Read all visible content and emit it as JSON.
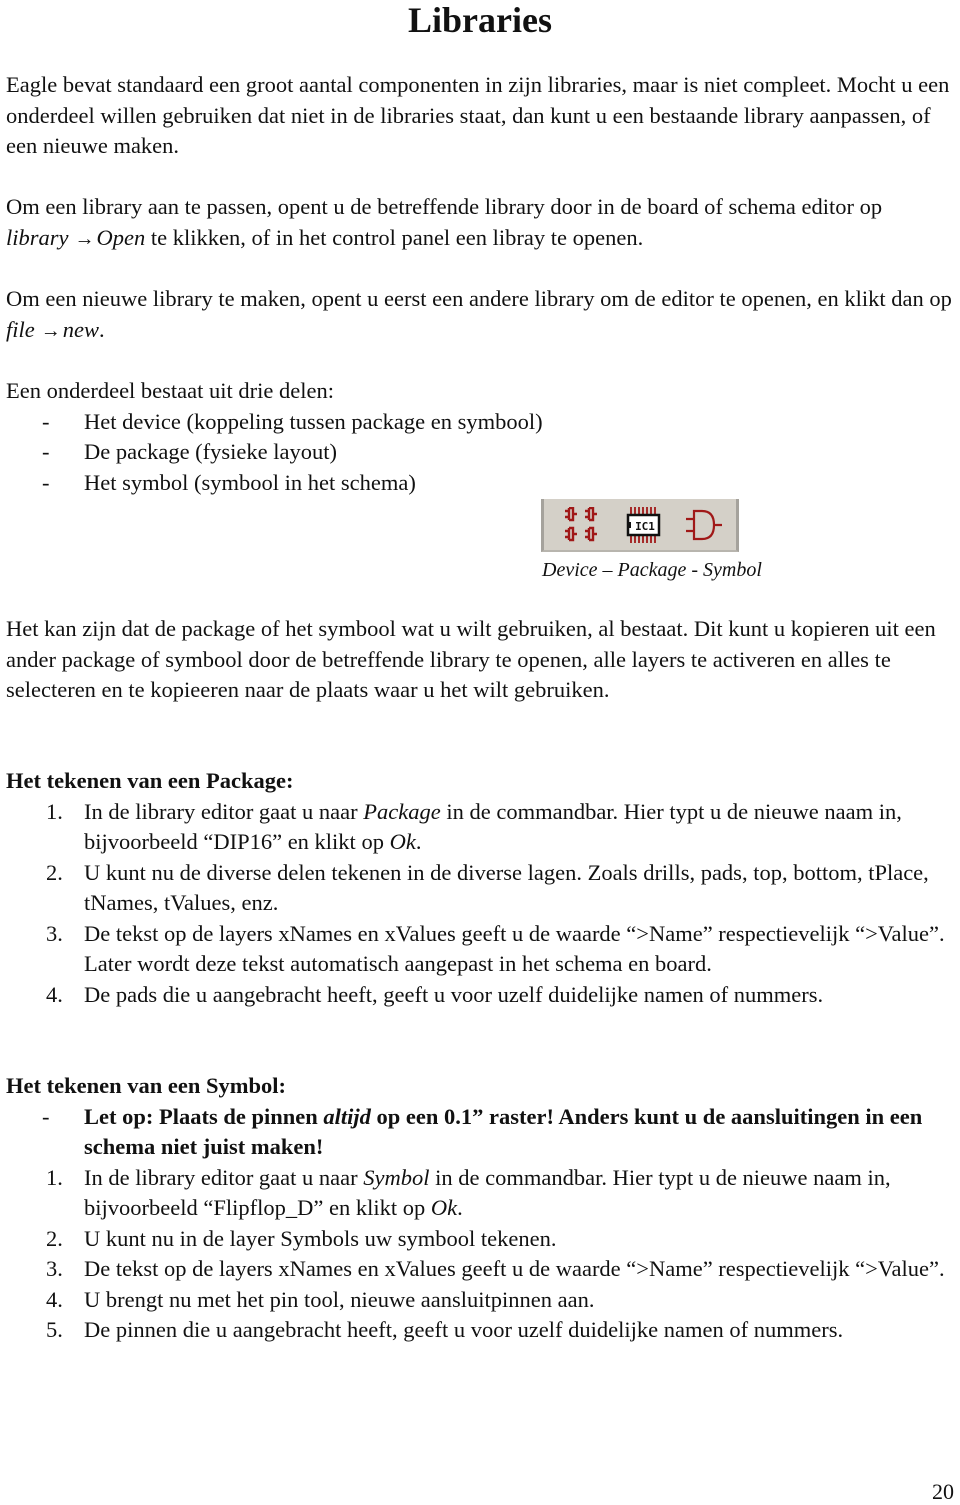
{
  "title": "Libraries",
  "intro": "Eagle bevat standaard een groot aantal componenten in zijn libraries, maar is niet compleet. Mocht u een onderdeel willen gebruiken dat niet in de libraries staat, dan kunt u een bestaande library aanpassen, of een nieuwe maken.",
  "open_library": {
    "before": "Om een library aan te passen, opent u de betreffende library door in de board of schema editor op ",
    "menu1": "library",
    "arrow": "→",
    "menu2": "Open",
    "after": " te klikken, of in het control panel een libray te openen."
  },
  "new_library": {
    "before": "Om een nieuwe library te maken, opent u eerst een andere library om de editor te openen, en klikt dan op ",
    "menu1": "file",
    "arrow": "→",
    "menu2": "new",
    "after": "."
  },
  "parts": {
    "intro": "Een onderdeel bestaat uit drie delen:",
    "marker": "-",
    "items": [
      "Het device (koppeling tussen package en symbool)",
      "De package (fysieke layout)",
      "Het symbol (symbool in het schema)"
    ]
  },
  "toolbar": {
    "icons": [
      "device-icon",
      "package-icon",
      "symbol-icon"
    ],
    "chip_label": "IC1",
    "icon_color": "#a01818",
    "background": "#d4d0c8",
    "caption": "Device – Package - Symbol"
  },
  "copy_paragraph": "Het kan zijn dat de package of het symbool wat u wilt gebruiken, al bestaat. Dit kunt u kopieren uit een ander package of symbool door de betreffende library te openen, alle layers te activeren en alles te selecteren en te kopieeren naar de plaats waar u het wilt gebruiken.",
  "package_section": {
    "heading": "Het tekenen van een Package:",
    "steps": [
      {
        "num": "1.",
        "a": "In de library editor gaat u naar ",
        "em": "Package",
        "b": " in de commandbar. Hier typt u de nieuwe naam in, bijvoorbeeld “DIP16” en klikt op ",
        "em2": "Ok",
        "c": "."
      },
      {
        "num": "2.",
        "text": "U kunt nu de diverse delen tekenen in de diverse lagen. Zoals drills, pads, top, bottom, tPlace, tNames, tValues, enz."
      },
      {
        "num": "3.",
        "text": "De tekst op de layers xNames en xValues geeft u de waarde “>Name” respectievelijk “>Value”. Later wordt deze tekst automatisch aangepast in het schema en board."
      },
      {
        "num": "4.",
        "text": "De pads die u aangebracht heeft, geeft u voor uzelf duidelijke namen of nummers."
      }
    ]
  },
  "symbol_section": {
    "heading": "Het tekenen van een Symbol:",
    "warning": {
      "marker": "-",
      "a": "Let op: Plaats de pinnen ",
      "em": "altijd",
      "b": " op een 0.1” raster! Anders kunt u de aansluitingen in een schema niet juist maken!"
    },
    "steps": [
      {
        "num": "1.",
        "a": "In de library editor gaat u naar ",
        "em": "Symbol",
        "b": " in de commandbar. Hier typt u de nieuwe naam in, bijvoorbeeld “Flipflop_D” en klikt op ",
        "em2": "Ok",
        "c": "."
      },
      {
        "num": "2.",
        "text": "U kunt nu in de layer Symbols uw symbool tekenen."
      },
      {
        "num": "3.",
        "text": "De tekst op de layers xNames en xValues geeft u de waarde “>Name” respectievelijk “>Value”."
      },
      {
        "num": "4.",
        "text": "U brengt nu met het pin tool, nieuwe aansluitpinnen aan."
      },
      {
        "num": "5.",
        "text": "De pinnen die u aangebracht heeft, geeft u voor uzelf duidelijke namen of nummers."
      }
    ]
  },
  "page_number": "20"
}
